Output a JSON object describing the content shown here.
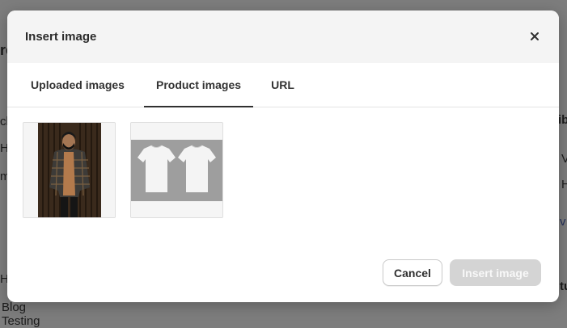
{
  "background": {
    "fragments": [
      "re",
      "cl",
      "He",
      "m",
      "He",
      "Blog Testing",
      "ib",
      "V",
      "H",
      "v",
      "tu"
    ]
  },
  "modal": {
    "title": "Insert image",
    "tabs": [
      {
        "label": "Uploaded images",
        "active": false
      },
      {
        "label": "Product images",
        "active": true
      },
      {
        "label": "URL",
        "active": false
      }
    ],
    "images": [
      {
        "name": "Man in plaid shirt"
      },
      {
        "name": "Two white t-shirts"
      }
    ],
    "cancel_label": "Cancel",
    "insert_label": "Insert image",
    "insert_disabled": true
  }
}
